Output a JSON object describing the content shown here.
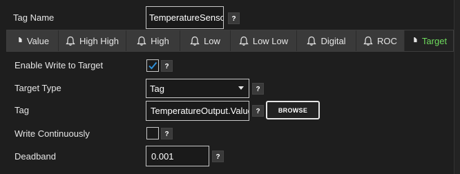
{
  "header": {
    "tag_name_label": "Tag Name",
    "tag_name_value": "TemperatureSensor",
    "help": "?"
  },
  "tabs": [
    {
      "label": "Value",
      "icon": "tag-icon"
    },
    {
      "label": "High High",
      "icon": "bell-icon"
    },
    {
      "label": "High",
      "icon": "bell-icon"
    },
    {
      "label": "Low",
      "icon": "bell-icon"
    },
    {
      "label": "Low Low",
      "icon": "bell-icon"
    },
    {
      "label": "Digital",
      "icon": "bell-icon"
    },
    {
      "label": "ROC",
      "icon": "bell-icon"
    },
    {
      "label": "Target",
      "icon": "tag-icon",
      "active": true
    }
  ],
  "form": {
    "enable_write": {
      "label": "Enable Write to Target",
      "checked": true
    },
    "target_type": {
      "label": "Target Type",
      "value": "Tag"
    },
    "tag": {
      "label": "Tag",
      "value": "TemperatureOutput.Value",
      "browse_label": "BROWSE"
    },
    "write_continuously": {
      "label": "Write Continuously",
      "checked": false
    },
    "deadband": {
      "label": "Deadband",
      "value": "0.001"
    }
  },
  "colors": {
    "background": "#1e1e1e",
    "tab_bg": "#3a3a3a",
    "active_tab_text": "#6fdc5e",
    "checkmark": "#2f8fd8",
    "input_border": "#c9c9c9"
  }
}
